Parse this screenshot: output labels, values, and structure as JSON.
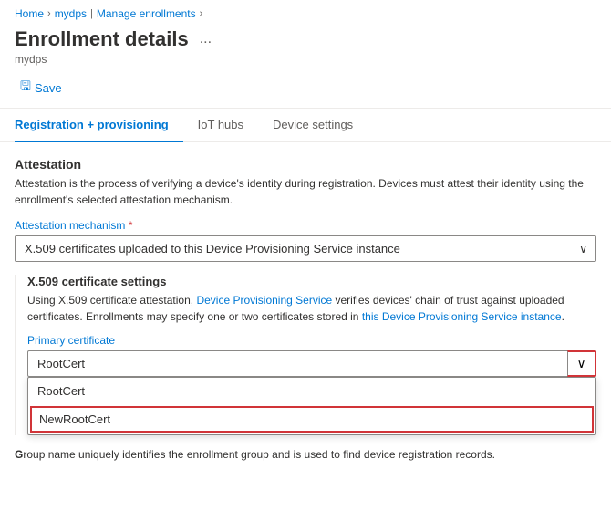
{
  "breadcrumb": {
    "items": [
      "Home",
      "mydps",
      "Manage enrollments"
    ],
    "separators": [
      ">",
      ">",
      ">"
    ]
  },
  "page": {
    "title": "Enrollment details",
    "ellipsis": "...",
    "subtitle": "mydps"
  },
  "toolbar": {
    "save_label": "Save",
    "save_icon": "💾"
  },
  "tabs": [
    {
      "id": "registration",
      "label": "Registration + provisioning",
      "active": true
    },
    {
      "id": "iot-hubs",
      "label": "IoT hubs",
      "active": false
    },
    {
      "id": "device-settings",
      "label": "Device settings",
      "active": false
    }
  ],
  "attestation": {
    "section_title": "Attestation",
    "description": "Attestation is the process of verifying a device's identity during registration. Devices must attest their identity using the enrollment's selected attestation mechanism.",
    "mechanism_label": "Attestation mechanism",
    "mechanism_required": true,
    "mechanism_value": "X.509 certificates uploaded to this Device Provisioning Service instance",
    "x509": {
      "section_title": "X.509 certificate settings",
      "description_part1": "Using X.509 certificate attestation, ",
      "description_link": "Device Provisioning Service",
      "description_part2": " verifies devices' chain of trust against uploaded certificates. Enrollments may specify one or two certificates stored in ",
      "description_link2": "this Device Provisioning Service instance",
      "description_part3": ".",
      "primary_cert_label": "Primary certificate",
      "primary_cert_value": "RootCert",
      "dropdown_options": [
        {
          "id": "rootcert",
          "label": "RootCert",
          "highlighted": false
        },
        {
          "id": "newrootcert",
          "label": "NewRootCert",
          "highlighted": true
        }
      ]
    }
  },
  "group": {
    "label": "G",
    "description": "Group name uniquely identifies the enrollment group and is used to find device registration records."
  }
}
